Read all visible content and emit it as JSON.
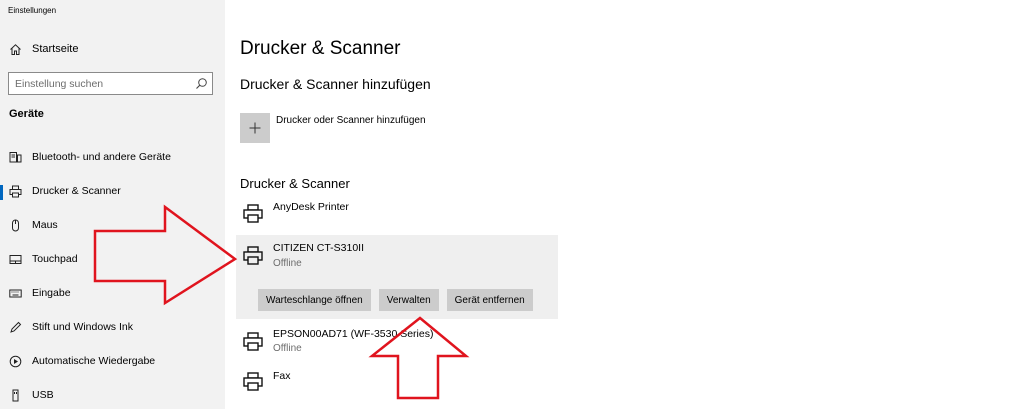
{
  "app": {
    "title": "Einstellungen"
  },
  "sidebar": {
    "home_label": "Startseite",
    "search_placeholder": "Einstellung suchen",
    "section_title": "Geräte",
    "items": [
      {
        "label": "Bluetooth- und andere Geräte",
        "icon": "bluetooth-devices-icon"
      },
      {
        "label": "Drucker & Scanner",
        "icon": "printer-icon",
        "selected": true
      },
      {
        "label": "Maus",
        "icon": "mouse-icon"
      },
      {
        "label": "Touchpad",
        "icon": "touchpad-icon"
      },
      {
        "label": "Eingabe",
        "icon": "keyboard-icon"
      },
      {
        "label": "Stift und Windows Ink",
        "icon": "pen-icon"
      },
      {
        "label": "Automatische Wiedergabe",
        "icon": "autoplay-icon"
      },
      {
        "label": "USB",
        "icon": "usb-icon"
      }
    ]
  },
  "main": {
    "title": "Drucker & Scanner",
    "add_section_title": "Drucker & Scanner hinzufügen",
    "add_button_label": "Drucker oder Scanner hinzufügen",
    "list_title": "Drucker & Scanner",
    "printers": [
      {
        "name": "AnyDesk Printer",
        "status": ""
      },
      {
        "name": "CITIZEN CT-S310II",
        "status": "Offline",
        "expanded": true
      },
      {
        "name": "EPSON00AD71 (WF-3530 Series)",
        "status": "Offline"
      },
      {
        "name": "Fax",
        "status": ""
      }
    ],
    "actions": {
      "queue_label": "Warteschlange öffnen",
      "manage_label": "Verwalten",
      "remove_label": "Gerät entfernen"
    }
  },
  "colors": {
    "sidebar_bg": "#f2f2f2",
    "accent": "#0067c0",
    "button_bg": "#cccccc",
    "annotation_arrow": "#e0141e"
  }
}
